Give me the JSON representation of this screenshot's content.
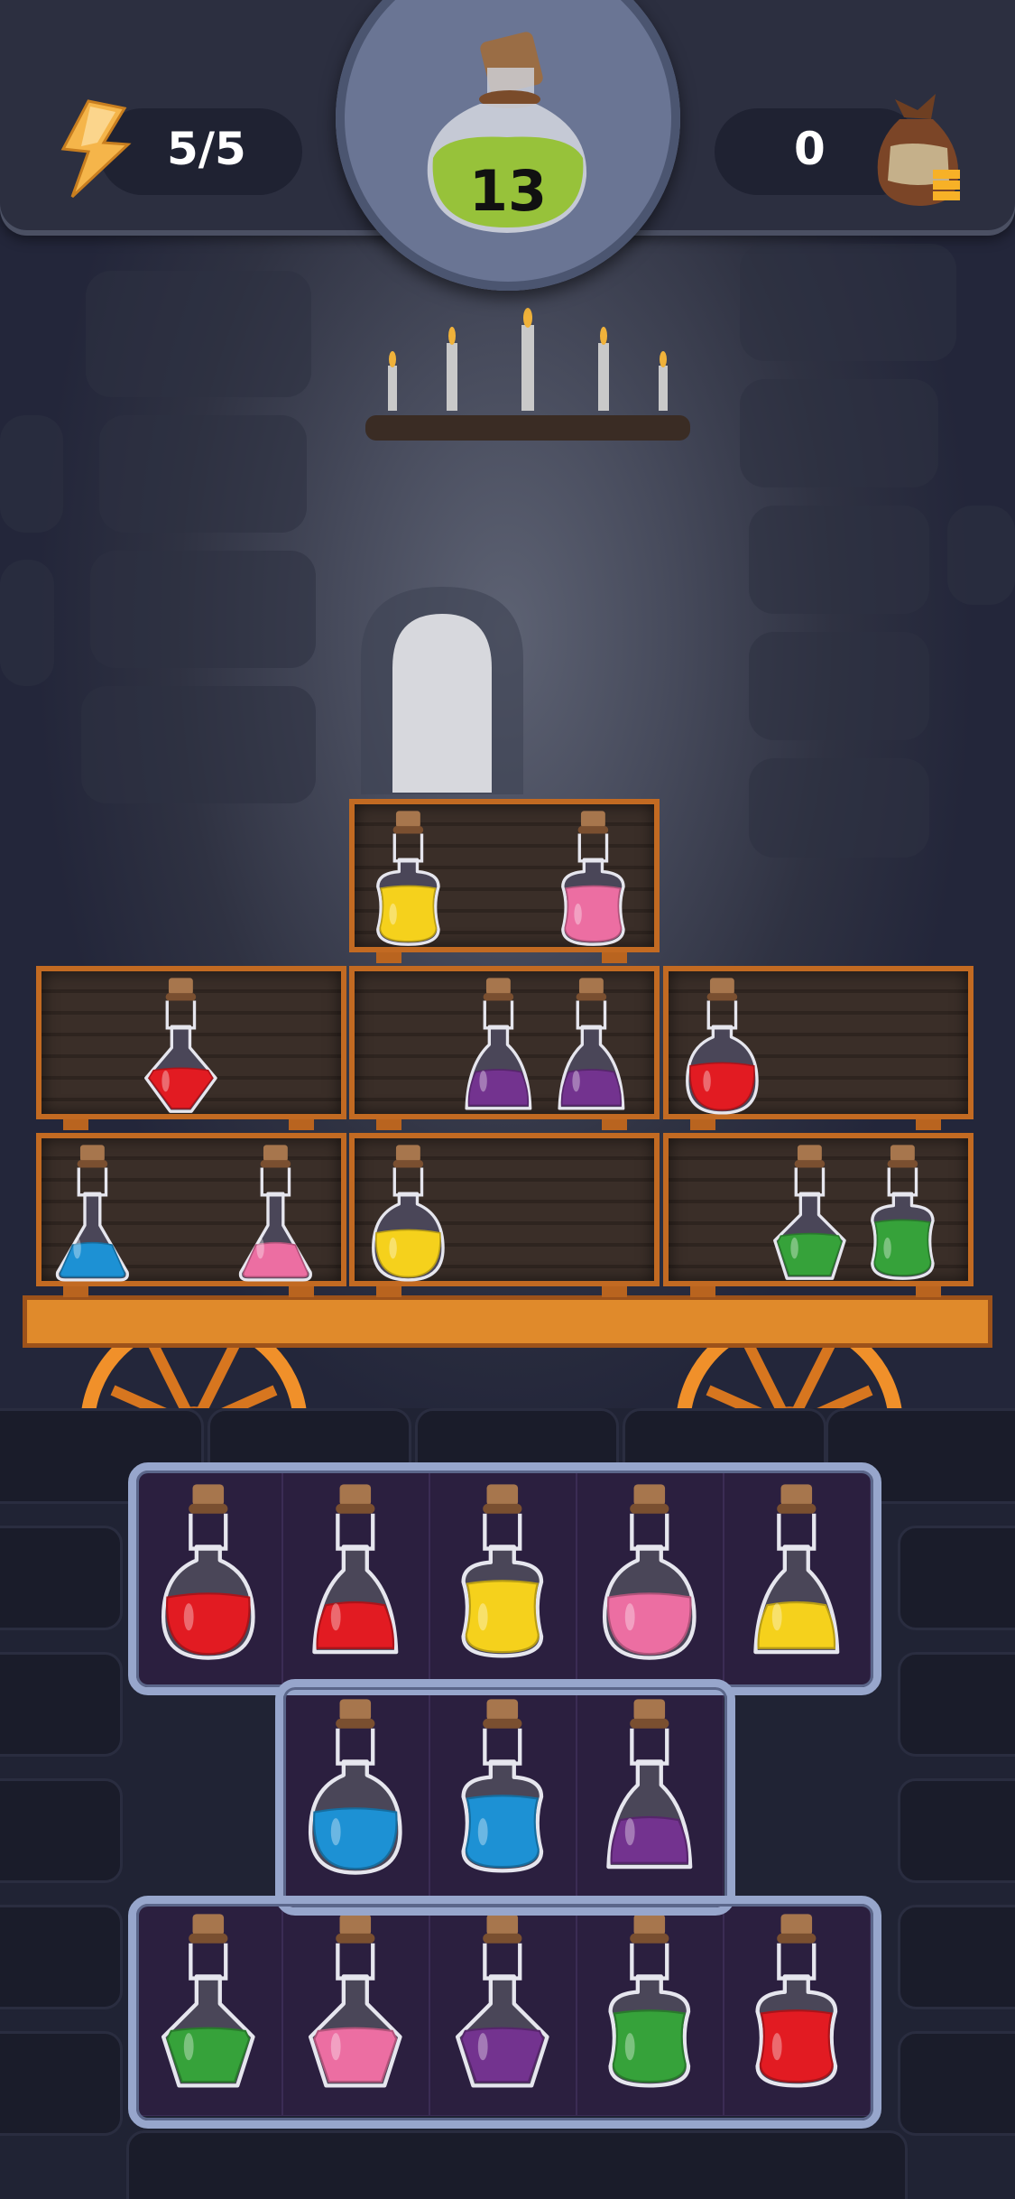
{
  "hud": {
    "energy": "5/5",
    "level": "13",
    "coins": "0"
  },
  "icons": {
    "energy": "lightning-bolt-icon",
    "level": "potion-flask-icon",
    "coins": "coin-sack-icon"
  },
  "colors": {
    "red": "#e21b22",
    "yellow": "#f5d11c",
    "pink": "#ec6ea2",
    "purple": "#73338f",
    "blue": "#1d91d4",
    "green": "#36a23a",
    "level_potion": "#97c23a",
    "shelf_wood": "#c26a22",
    "board_frame": "#97a6cc"
  },
  "cart": {
    "shelves": [
      {
        "row": 0,
        "col": 1,
        "bottles": [
          {
            "color": "yellow",
            "shape": "square"
          },
          {
            "color": "pink",
            "shape": "square"
          }
        ]
      },
      {
        "row": 1,
        "col": 0,
        "bottles": [
          {
            "color": "red",
            "shape": "diamond"
          }
        ]
      },
      {
        "row": 1,
        "col": 1,
        "bottles": [
          {
            "color": "purple",
            "shape": "bell"
          },
          {
            "color": "purple",
            "shape": "bell"
          }
        ]
      },
      {
        "row": 1,
        "col": 2,
        "bottles": [
          {
            "color": "red",
            "shape": "round"
          }
        ]
      },
      {
        "row": 2,
        "col": 0,
        "bottles": [
          {
            "color": "blue",
            "shape": "flask"
          },
          {
            "color": "pink",
            "shape": "flask"
          }
        ]
      },
      {
        "row": 2,
        "col": 1,
        "bottles": [
          {
            "color": "yellow",
            "shape": "round"
          }
        ]
      },
      {
        "row": 2,
        "col": 2,
        "bottles": [
          {
            "color": "green",
            "shape": "pentagon"
          },
          {
            "color": "green",
            "shape": "square"
          }
        ]
      }
    ]
  },
  "board": {
    "rows": [
      [
        {
          "color": "red",
          "shape": "round"
        },
        {
          "color": "red",
          "shape": "bell"
        },
        {
          "color": "yellow",
          "shape": "square"
        },
        {
          "color": "pink",
          "shape": "round"
        },
        {
          "color": "yellow",
          "shape": "bell"
        }
      ],
      [
        null,
        {
          "color": "blue",
          "shape": "round"
        },
        {
          "color": "blue",
          "shape": "square"
        },
        {
          "color": "purple",
          "shape": "bell"
        },
        null
      ],
      [
        {
          "color": "green",
          "shape": "pentagon"
        },
        {
          "color": "pink",
          "shape": "pentagon"
        },
        {
          "color": "purple",
          "shape": "pentagon"
        },
        {
          "color": "green",
          "shape": "square"
        },
        {
          "color": "red",
          "shape": "square"
        }
      ]
    ]
  }
}
